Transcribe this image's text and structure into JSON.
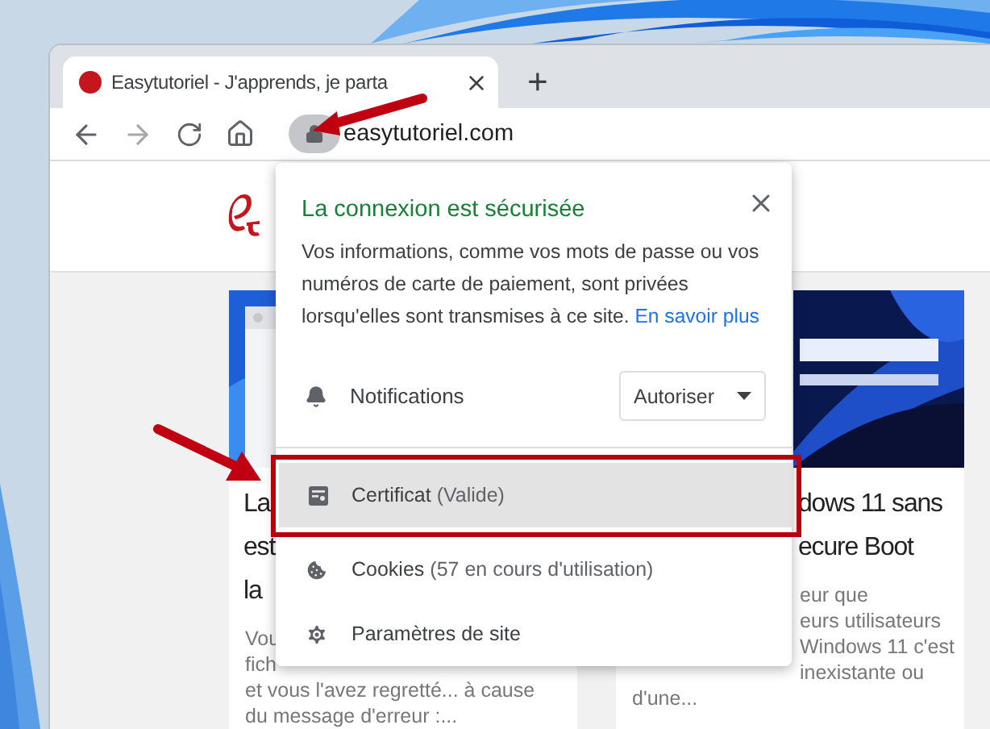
{
  "tab": {
    "title": "Easytutoriel - J'apprends, je parta",
    "selected": true
  },
  "new_tab": "+",
  "nav": [
    {
      "kind": "back",
      "disabled": false
    },
    {
      "kind": "forward",
      "disabled": true
    },
    {
      "kind": "reload",
      "disabled": false
    },
    {
      "kind": "home",
      "disabled": false
    }
  ],
  "address": "easytutoriel.com",
  "popup": {
    "title": "La connexion est sécurisée",
    "description": "Vos informations, comme vos mots de passe ou vos numéros de carte de paiement, sont privées lorsqu'elles sont transmises à ce site.",
    "link": "En savoir plus",
    "permission": {
      "label": "Notifications",
      "value": "Autoriser"
    },
    "items": [
      {
        "kind": "certificate",
        "label": "Certificat",
        "detail": "(Valide)",
        "selected": true
      },
      {
        "kind": "cookies",
        "label": "Cookies",
        "detail": "(57 en cours d'utilisation)",
        "selected": false
      },
      {
        "kind": "settings",
        "label": "Paramètres de site",
        "selected": false
      }
    ]
  },
  "cards": [
    {
      "title_lines": [
        "La",
        "est",
        "la"
      ],
      "excerpt_lines": [
        "Vou",
        "fich",
        "et vous l'avez regretté... à cause",
        "du message d'erreur :..."
      ]
    },
    {
      "title_lines": [
        "dows 11 sans",
        "ecure Boot"
      ],
      "excerpt_lines": [
        "eur que",
        "eurs utilisateurs",
        "Windows 11 c'est",
        "inexistante ou",
        "d'une..."
      ]
    }
  ]
}
